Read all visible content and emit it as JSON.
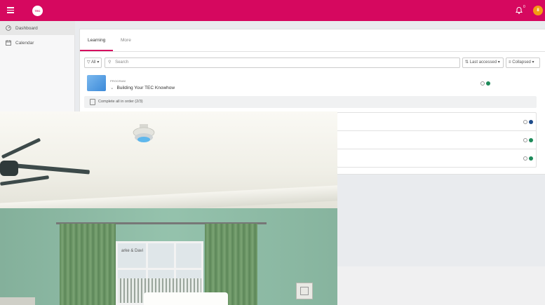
{
  "topbar": {
    "logo_text": "TEC",
    "notification_count": "0",
    "avatar_initial": "8",
    "accent_color": "#d6085f"
  },
  "sidebar": {
    "items": [
      {
        "label": "Dashboard",
        "icon": "gauge-icon",
        "active": true
      },
      {
        "label": "Calendar",
        "icon": "calendar-icon",
        "active": false
      }
    ]
  },
  "main": {
    "tabs": [
      {
        "label": "Learning",
        "active": true
      },
      {
        "label": "More",
        "active": false
      }
    ],
    "filter_label": "All",
    "search_placeholder": "Search",
    "sort_label": "Last accessed",
    "view_label": "Collapsed",
    "program": {
      "type": "PROGRAM",
      "title": "Building Your TEC Knowhow",
      "status_color": "#1e8a5a",
      "order_text": "Complete all in order (2/3)"
    },
    "sub_rows": [
      {
        "status_color": "#1c4a8a"
      },
      {
        "status_color": "#1e8a5a"
      },
      {
        "status_color": "#1e8a5a"
      }
    ]
  },
  "overlay": {
    "window_text": "arke & Davi"
  }
}
